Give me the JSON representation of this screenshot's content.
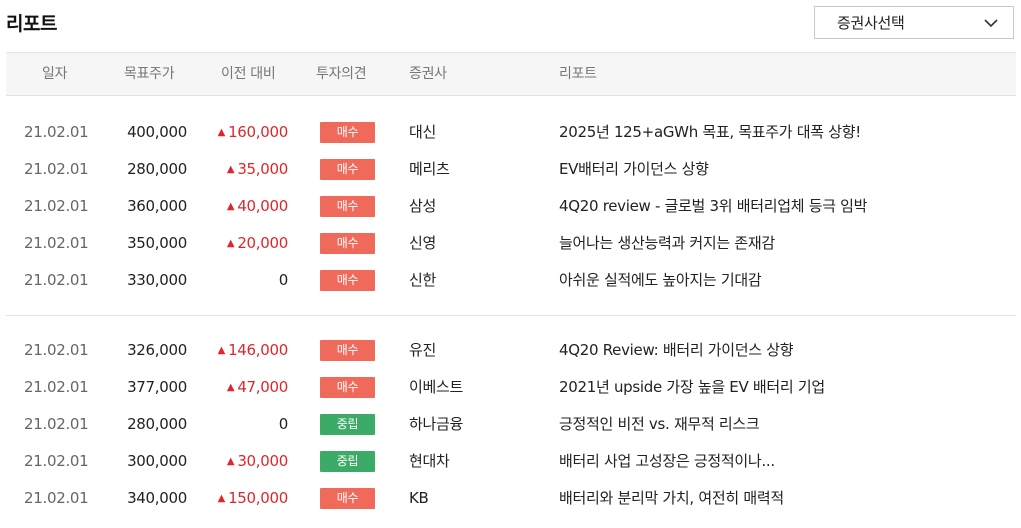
{
  "page": {
    "title": "리포트"
  },
  "broker_select": {
    "label": "증권사선택",
    "icon": "chevron-down-icon"
  },
  "columns": [
    "일자",
    "목표주가",
    "이전 대비",
    "투자의견",
    "증권사",
    "리포트"
  ],
  "colors": {
    "up": "#e0262b",
    "buy_badge": "#f06a5c",
    "neutral_badge": "#3dab68"
  },
  "groups": [
    {
      "rows": [
        {
          "date": "21.02.01",
          "target_price": "400,000",
          "change": "160,000",
          "direction": "up",
          "opinion": "매수",
          "opinion_type": "buy",
          "firm": "대신",
          "report": "2025년 125+aGWh 목표, 목표주가 대폭 상향!"
        },
        {
          "date": "21.02.01",
          "target_price": "280,000",
          "change": "35,000",
          "direction": "up",
          "opinion": "매수",
          "opinion_type": "buy",
          "firm": "메리츠",
          "report": "EV배터리 가이던스 상향"
        },
        {
          "date": "21.02.01",
          "target_price": "360,000",
          "change": "40,000",
          "direction": "up",
          "opinion": "매수",
          "opinion_type": "buy",
          "firm": "삼성",
          "report": "4Q20 review - 글로벌 3위 배터리업체 등극 임박"
        },
        {
          "date": "21.02.01",
          "target_price": "350,000",
          "change": "20,000",
          "direction": "up",
          "opinion": "매수",
          "opinion_type": "buy",
          "firm": "신영",
          "report": "늘어나는 생산능력과 커지는 존재감"
        },
        {
          "date": "21.02.01",
          "target_price": "330,000",
          "change": "0",
          "direction": "none",
          "opinion": "매수",
          "opinion_type": "buy",
          "firm": "신한",
          "report": "아쉬운 실적에도 높아지는 기대감"
        }
      ]
    },
    {
      "rows": [
        {
          "date": "21.02.01",
          "target_price": "326,000",
          "change": "146,000",
          "direction": "up",
          "opinion": "매수",
          "opinion_type": "buy",
          "firm": "유진",
          "report": "4Q20 Review: 배터리 가이던스 상향"
        },
        {
          "date": "21.02.01",
          "target_price": "377,000",
          "change": "47,000",
          "direction": "up",
          "opinion": "매수",
          "opinion_type": "buy",
          "firm": "이베스트",
          "report": "2021년 upside 가장 높을 EV 배터리 기업"
        },
        {
          "date": "21.02.01",
          "target_price": "280,000",
          "change": "0",
          "direction": "none",
          "opinion": "중립",
          "opinion_type": "neutral",
          "firm": "하나금융",
          "report": "긍정적인 비전 vs. 재무적 리스크"
        },
        {
          "date": "21.02.01",
          "target_price": "300,000",
          "change": "30,000",
          "direction": "up",
          "opinion": "중립",
          "opinion_type": "neutral",
          "firm": "현대차",
          "report": "배터리 사업 고성장은 긍정적이나..."
        },
        {
          "date": "21.02.01",
          "target_price": "340,000",
          "change": "150,000",
          "direction": "up",
          "opinion": "매수",
          "opinion_type": "buy",
          "firm": "KB",
          "report": "배터리와 분리막 가치, 여전히 매력적"
        }
      ]
    }
  ]
}
